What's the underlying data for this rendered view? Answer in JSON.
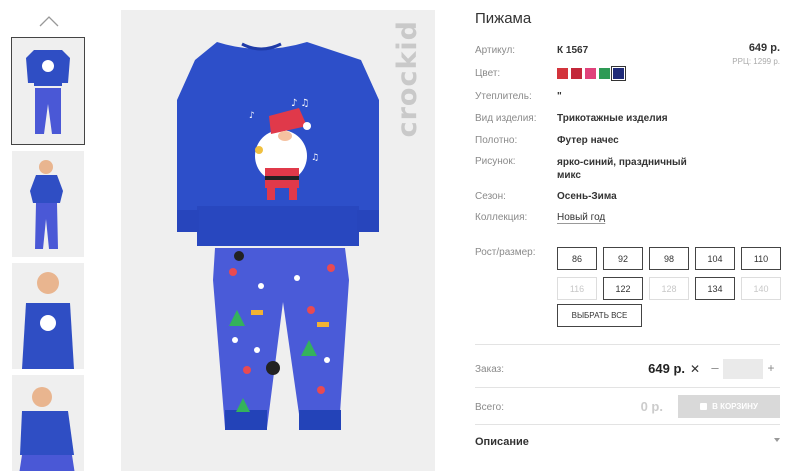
{
  "product": {
    "title": "Пижама",
    "brand": "crockid",
    "price": "649 р.",
    "rrp": "РРЦ: 1299 р."
  },
  "attributes": [
    {
      "label": "Артикул:",
      "value": "К 1567"
    },
    {
      "label": "Цвет:",
      "value": ""
    },
    {
      "label": "Утеплитель:",
      "value": "\""
    },
    {
      "label": "Вид изделия:",
      "value": "Трикотажные изделия"
    },
    {
      "label": "Полотно:",
      "value": "Футер начес"
    },
    {
      "label": "Рисунок:",
      "value": "ярко-синий, праздничный микс"
    },
    {
      "label": "Сезон:",
      "value": "Осень-Зима"
    },
    {
      "label": "Коллекция:",
      "value": "Новый год"
    }
  ],
  "colors": [
    {
      "name": "red",
      "hex": "#d3343c"
    },
    {
      "name": "crimson",
      "hex": "#c3273a"
    },
    {
      "name": "pink",
      "hex": "#e0427b"
    },
    {
      "name": "green",
      "hex": "#2e9a55"
    },
    {
      "name": "navy",
      "hex": "#1f2a78",
      "selected": true
    }
  ],
  "sizes_label": "Рост/размер:",
  "sizes": [
    {
      "label": "86",
      "available": true
    },
    {
      "label": "92",
      "available": true
    },
    {
      "label": "98",
      "available": true
    },
    {
      "label": "104",
      "available": true
    },
    {
      "label": "110",
      "available": true
    },
    {
      "label": "116",
      "available": false
    },
    {
      "label": "122",
      "available": true
    },
    {
      "label": "128",
      "available": false
    },
    {
      "label": "134",
      "available": true
    },
    {
      "label": "140",
      "available": false
    }
  ],
  "select_all_label": "ВЫБРАТЬ ВСЕ",
  "order": {
    "label": "Заказ:",
    "price": "649 р.",
    "times": "✕",
    "minus": "–",
    "plus": "+",
    "quantity": ""
  },
  "total": {
    "label": "Всего:",
    "value": "0 р.",
    "cart_button": "В КОРЗИНУ"
  },
  "description_label": "Описание",
  "icons": {
    "thumbs_up_arrow": "chevron-up-icon",
    "cart": "cart-icon",
    "expand": "chevron-down-icon"
  }
}
